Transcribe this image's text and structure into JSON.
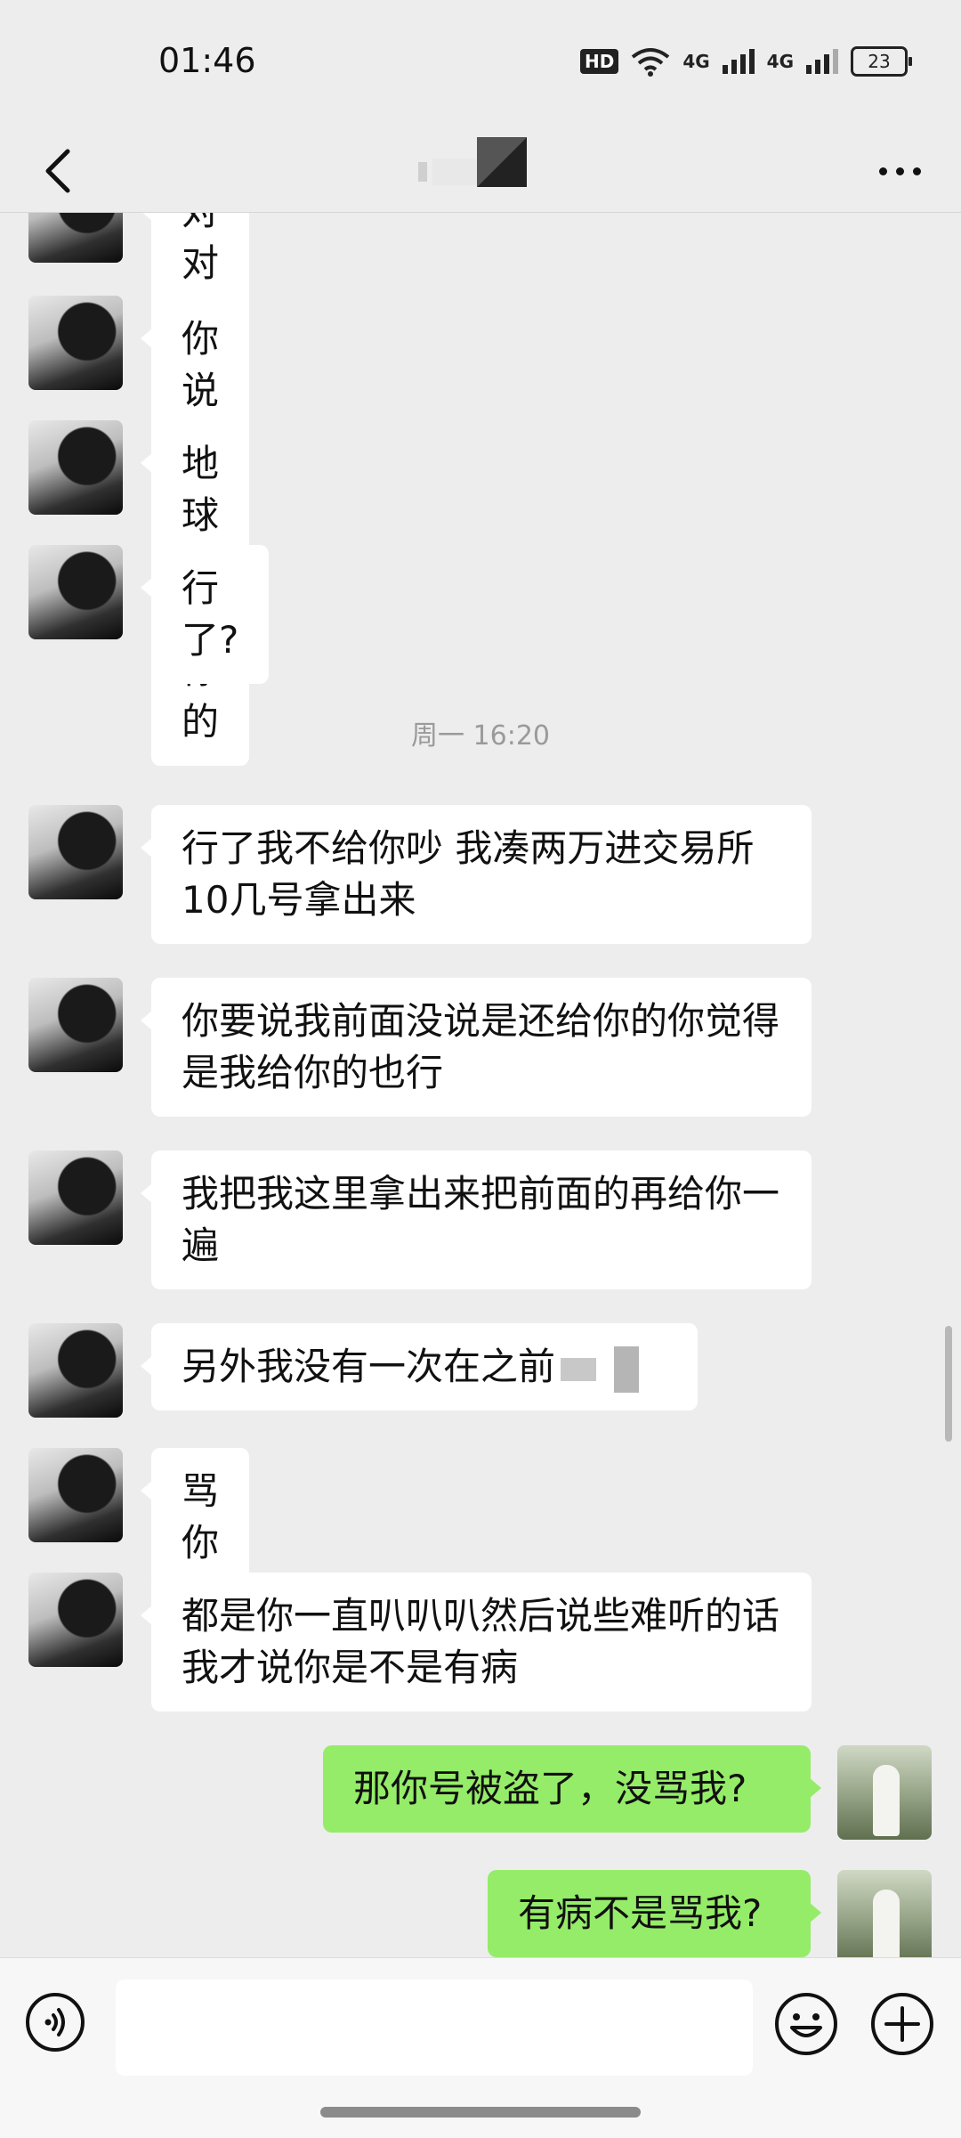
{
  "status": {
    "time": "01:46",
    "hd": "HD",
    "network": "4G",
    "battery": "23"
  },
  "nav": {
    "back_icon": "chevron-left-icon",
    "more_icon": "more-dots-icon"
  },
  "messages": [
    {
      "side": "left",
      "text": "对对对"
    },
    {
      "side": "left",
      "text": "你说啥是啥"
    },
    {
      "side": "left",
      "text": "地球都是你的"
    },
    {
      "side": "left",
      "text": "行了?"
    },
    {
      "side": "left",
      "text": "行了我不给你吵 我凑两万进交易所 10几号拿出来"
    },
    {
      "side": "left",
      "text": "你要说我前面没说是还给你的你觉得是我给你的也行"
    },
    {
      "side": "left",
      "text": "我把我这里拿出来把前面的再给你一遍"
    },
    {
      "side": "left",
      "text": "另外我没有一次在之前"
    },
    {
      "side": "left",
      "text": "骂你"
    },
    {
      "side": "left",
      "text": "都是你一直叭叭叭然后说些难听的话我才说你是不是有病"
    },
    {
      "side": "right",
      "text": "那你号被盗了，没骂我?"
    },
    {
      "side": "right",
      "text": "有病不是骂我?"
    }
  ],
  "timestamp": "周一 16:20",
  "input": {
    "placeholder": ""
  }
}
